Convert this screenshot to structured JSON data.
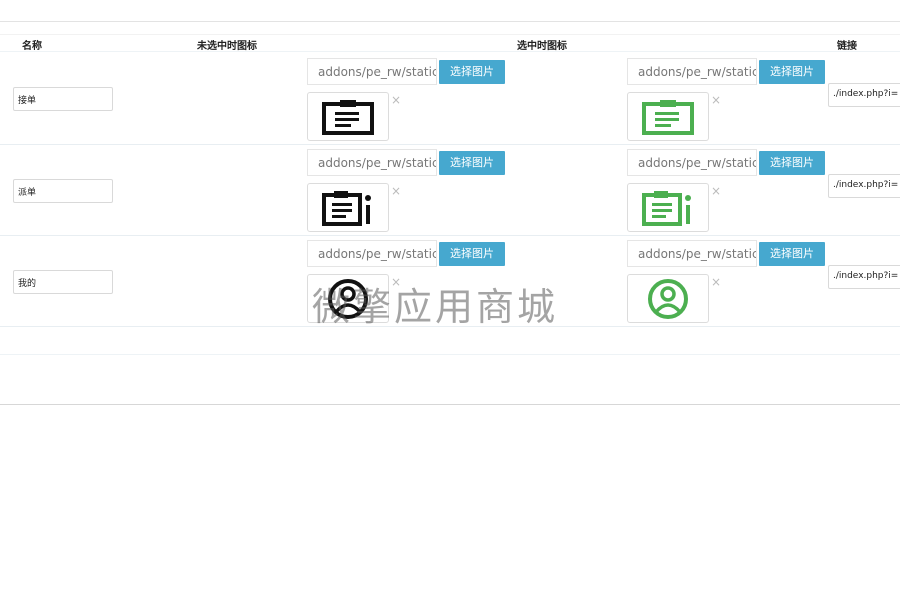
{
  "table": {
    "headers": {
      "name": "名称",
      "unselected_icon": "未选中时图标",
      "selected_icon": "选中时图标",
      "link": "链接"
    },
    "rows": [
      {
        "name": "接单",
        "unselected_path": "addons/pe_rw/static",
        "selected_path": "addons/pe_rw/static",
        "pick_label": "选择图片",
        "remove_glyph": "×",
        "unselected_icon": "clipboard-icon",
        "selected_icon": "clipboard-icon",
        "link": "./index.php?i="
      },
      {
        "name": "派单",
        "unselected_path": "addons/pe_rw/static",
        "selected_path": "addons/pe_rw/static",
        "pick_label": "选择图片",
        "remove_glyph": "×",
        "unselected_icon": "dispatch-list-icon",
        "selected_icon": "dispatch-list-icon",
        "link": "./index.php?i="
      },
      {
        "name": "我的",
        "unselected_path": "addons/pe_rw/static",
        "selected_path": "addons/pe_rw/static",
        "pick_label": "选择图片",
        "remove_glyph": "×",
        "unselected_icon": "user-circle-icon",
        "selected_icon": "user-circle-icon",
        "link": "./index.php?i="
      }
    ]
  },
  "watermark": "微擎应用商城",
  "colors": {
    "button": "#46a8cf",
    "icon_unselected": "#111111",
    "icon_selected": "#4caf50"
  }
}
